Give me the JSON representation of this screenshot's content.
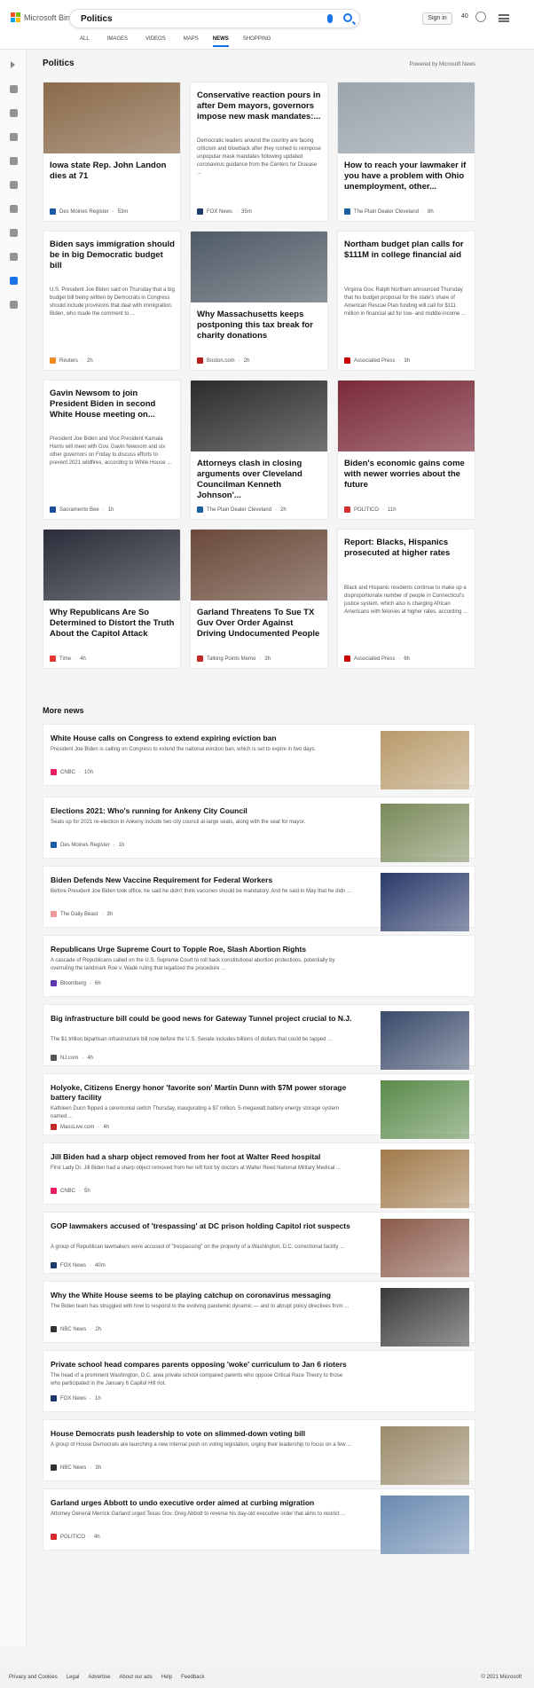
{
  "header": {
    "brand": "Microsoft Bing",
    "query": "Politics",
    "signin": "Sign in",
    "rewards": "40",
    "tabs": [
      "ALL",
      "IMAGES",
      "VIDEOS",
      "MAPS",
      "NEWS",
      "SHOPPING"
    ]
  },
  "section": {
    "title": "Politics",
    "powered": "Powered by Microsoft News"
  },
  "cards": [
    {
      "title": "Iowa state Rep. John Landon dies at 71",
      "snippet": "",
      "source": "Des Moines Register",
      "time": "53m",
      "color": "#8a6a4a",
      "icon": "#1d5aa6"
    },
    {
      "title": "Conservative reaction pours in after Dem mayors, governors impose new mask mandates:...",
      "snippet": "Democratic leaders around the country are facing criticism and blowback after they rushed to reimpose unpopular mask mandates following updated coronavirus guidance from the Centers for Disease ...",
      "source": "FOX News",
      "time": "35m",
      "color": "",
      "icon": "#1e3a6a"
    },
    {
      "title": "How to reach your lawmaker if you have a problem with Ohio unemployment, other...",
      "snippet": "",
      "source": "The Plain Dealer Cleveland",
      "time": "8h",
      "color": "#9aa4ad",
      "icon": "#1a5fa0"
    },
    {
      "title": "Biden says immigration should be in big Democratic budget bill",
      "snippet": "U.S. President Joe Biden said on Thursday that a big budget bill being written by Democrats in Congress should include provisions that deal with immigration. Biden, who made the comment to ...",
      "source": "Reuters",
      "time": "2h",
      "color": "",
      "icon": "#f08a24"
    },
    {
      "title": "Why Massachusetts keeps postponing this tax break for charity donations",
      "snippet": "",
      "source": "Boston.com",
      "time": "2h",
      "color": "#4f5b66",
      "icon": "#b71c1c"
    },
    {
      "title": "Northam budget plan calls for $111M in college financial aid",
      "snippet": "Virginia Gov. Ralph Northam announced Thursday that his budget proposal for the state's share of American Rescue Plan funding will call for $111 million in financial aid for low- and middle-income ...",
      "source": "Associated Press",
      "time": "3h",
      "color": "",
      "icon": "#c00"
    },
    {
      "title": "Gavin Newsom to join President Biden in second White House meeting on...",
      "snippet": "President Joe Biden and Vice President Kamala Harris will meet with Gov. Gavin Newsom and six other governors on Friday to discuss efforts to prevent 2021 wildfires, according to White House ...",
      "source": "Sacramento Bee",
      "time": "1h",
      "color": "",
      "icon": "#1b4f9a"
    },
    {
      "title": "Attorneys clash in closing arguments over Cleveland Councilman Kenneth Johnson'...",
      "snippet": "",
      "source": "The Plain Dealer Cleveland",
      "time": "2h",
      "color": "#2c2c2c",
      "icon": "#1a5fa0"
    },
    {
      "title": "Biden's economic gains come with newer worries about the future",
      "snippet": "",
      "source": "POLITICO",
      "time": "11h",
      "color": "#7a2a3a",
      "icon": "#d32f2f"
    },
    {
      "title": "Why Republicans Are So Determined to Distort the Truth About the Capitol Attack",
      "snippet": "",
      "source": "Time",
      "time": "4h",
      "color": "#2a2e3a",
      "icon": "#e53935"
    },
    {
      "title": "Garland Threatens To Sue TX Guv Over Order Against Driving Undocumented People",
      "snippet": "",
      "source": "Talking Points Memo",
      "time": "3h",
      "color": "#6a4a3a",
      "icon": "#c62828"
    },
    {
      "title": "Report: Blacks, Hispanics prosecuted at higher rates",
      "snippet": "Black and Hispanic residents continue to make up a disproportionate number of people in Connecticut's justice system, which also is charging African Americans with felonies at higher rates, according ...",
      "source": "Associated Press",
      "time": "6h",
      "color": "",
      "icon": "#c00"
    }
  ],
  "more": {
    "title": "More news"
  },
  "items": [
    {
      "title": "White House calls on Congress to extend expiring eviction ban",
      "snippet": "President Joe Biden is calling on Congress to extend the national eviction ban, which is set to expire in two days.",
      "source": "CNBC",
      "time": "10h",
      "thumb": "#b89a6a",
      "icon": "#e91e63"
    },
    {
      "title": "Elections 2021: Who's running for Ankeny City Council",
      "snippet": "Seats up for 2021 re-election in Ankeny include two city council at-large seats, along with the seat for mayor.",
      "source": "Des Moines Register",
      "time": "1h",
      "thumb": "#7a8a5a",
      "icon": "#1d5aa6"
    },
    {
      "title": "Biden Defends New Vaccine Requirement for Federal Workers",
      "snippet": "Before President Joe Biden took office, he said he didn't think vaccines should be mandatory. And he said in May that he didn ...",
      "source": "The Daily Beast",
      "time": "3h",
      "thumb": "#2a3a6a",
      "icon": "#ef9a9a"
    },
    {
      "title": "Republicans Urge Supreme Court to Topple Roe, Slash Abortion Rights",
      "snippet": "A cascade of Republicans called on the U.S. Supreme Court to roll back constitutional abortion protections, potentially by overruling the landmark Roe v. Wade ruling that legalized the procedure ...",
      "source": "Bloomberg",
      "time": "6h",
      "thumb": "",
      "icon": "#5e35b1"
    },
    {
      "title": "Big infrastructure bill could be good news for Gateway Tunnel project crucial to N.J.",
      "snippet": "The $1 trillion bipartisan infrastructure bill now before the U.S. Senate includes billions of dollars that could be tapped ...",
      "source": "NJ.com",
      "time": "4h",
      "thumb": "#3a4a6a",
      "icon": "#555"
    },
    {
      "title": "Holyoke, Citizens Energy honor 'favorite son' Martin Dunn with $7M power storage battery facility",
      "snippet": "Kathleen Dunn flipped a ceremonial switch Thursday, inaugurating a $7 million, 5-megawatt battery energy storage system named ...",
      "source": "MassLive.com",
      "time": "4h",
      "thumb": "#5a8a4a",
      "icon": "#c62828"
    },
    {
      "title": "Jill Biden had a sharp object removed from her foot at Walter Reed hospital",
      "snippet": "First Lady Dr. Jill Biden had a sharp object removed from her left foot by doctors at Walter Reed National Military Medical ...",
      "source": "CNBC",
      "time": "5h",
      "thumb": "#a07a4a",
      "icon": "#e91e63"
    },
    {
      "title": "GOP lawmakers accused of 'trespassing' at DC prison holding Capitol riot suspects",
      "snippet": "A group of Republican lawmakers were accused of \"trespassing\" on the property of a Washington, D.C. correctional facility ...",
      "source": "FOX News",
      "time": "40m",
      "thumb": "#8a5a4a",
      "icon": "#1e3a6a"
    },
    {
      "title": "Why the White House seems to be playing catchup on coronavirus messaging",
      "snippet": "The Biden team has struggled with how to respond to the evolving pandemic dynamic — and to abrupt policy directives from ...",
      "source": "NBC News",
      "time": "2h",
      "thumb": "#3a3a3a",
      "icon": "#333"
    },
    {
      "title": "Private school head compares parents opposing 'woke' curriculum to Jan 6 rioters",
      "snippet": "The head of a prominent Washington, D.C. area private school compared parents who oppose Critical Race Theory to those who participated in the January 6 Capitol Hill riot.",
      "source": "FOX News",
      "time": "1h",
      "thumb": "",
      "icon": "#1e3a6a"
    },
    {
      "title": "House Democrats push leadership to vote on slimmed-down voting bill",
      "snippet": "A group of House Democrats are launching a new internal push on voting legislation, urging their leadership to focus on a few ...",
      "source": "NBC News",
      "time": "3h",
      "thumb": "#9a8a6a",
      "icon": "#333"
    },
    {
      "title": "Garland urges Abbott to undo executive order aimed at curbing migration",
      "snippet": "Attorney General Merrick Garland urged Texas Gov. Greg Abbott to reverse his day-old executive order that aims to restrict ...",
      "source": "POLITICO",
      "time": "4h",
      "thumb": "#6a8ab0",
      "icon": "#d32f2f"
    }
  ],
  "footer": {
    "links": [
      "Privacy and Cookies",
      "Legal",
      "Advertise",
      "About our ads",
      "Help",
      "Feedback"
    ],
    "copy": "© 2021 Microsoft"
  }
}
